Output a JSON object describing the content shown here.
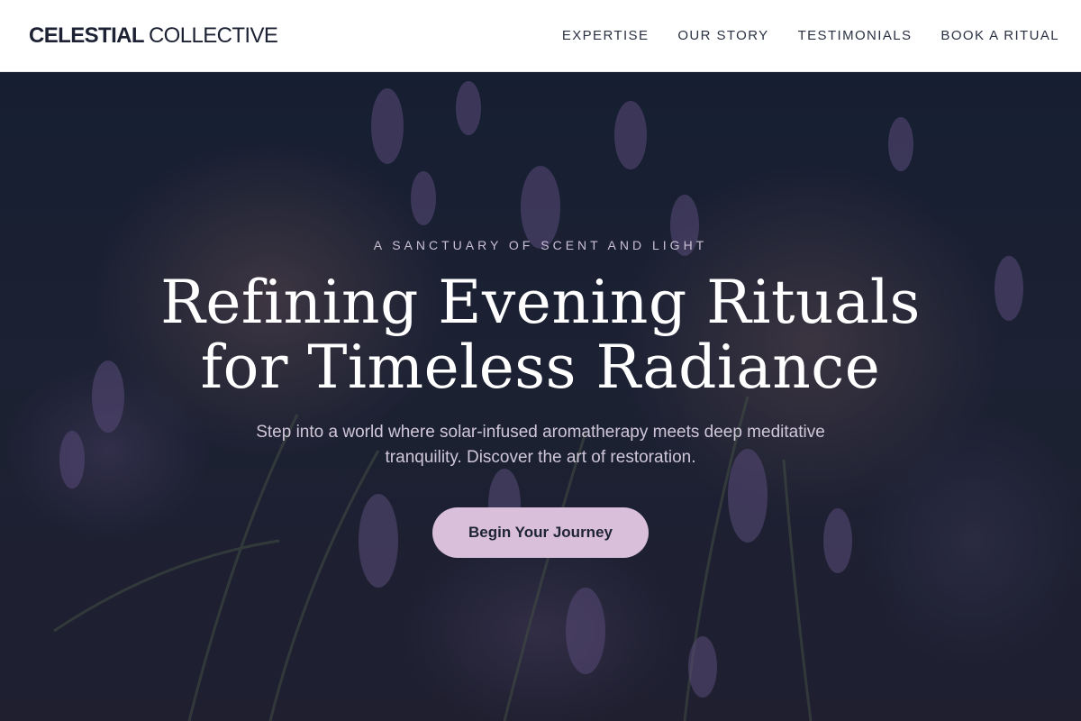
{
  "header": {
    "logo_strong": "CELESTIAL",
    "logo_light": "COLLECTIVE",
    "nav": [
      "EXPERTISE",
      "OUR STORY",
      "TESTIMONIALS",
      "BOOK A RITUAL"
    ]
  },
  "hero": {
    "eyebrow": "A SANCTUARY OF SCENT AND LIGHT",
    "headline_line1": "Refining Evening Rituals",
    "headline_line2": "for Timeless Radiance",
    "subtext": "Step into a world where solar-infused aromatherapy meets deep meditative tranquility. Discover the art of restoration.",
    "cta_label": "Begin Your Journey"
  },
  "colors": {
    "accent": "#d9bfd9",
    "header_bg": "#ffffff",
    "hero_tint": "#1b2438"
  }
}
